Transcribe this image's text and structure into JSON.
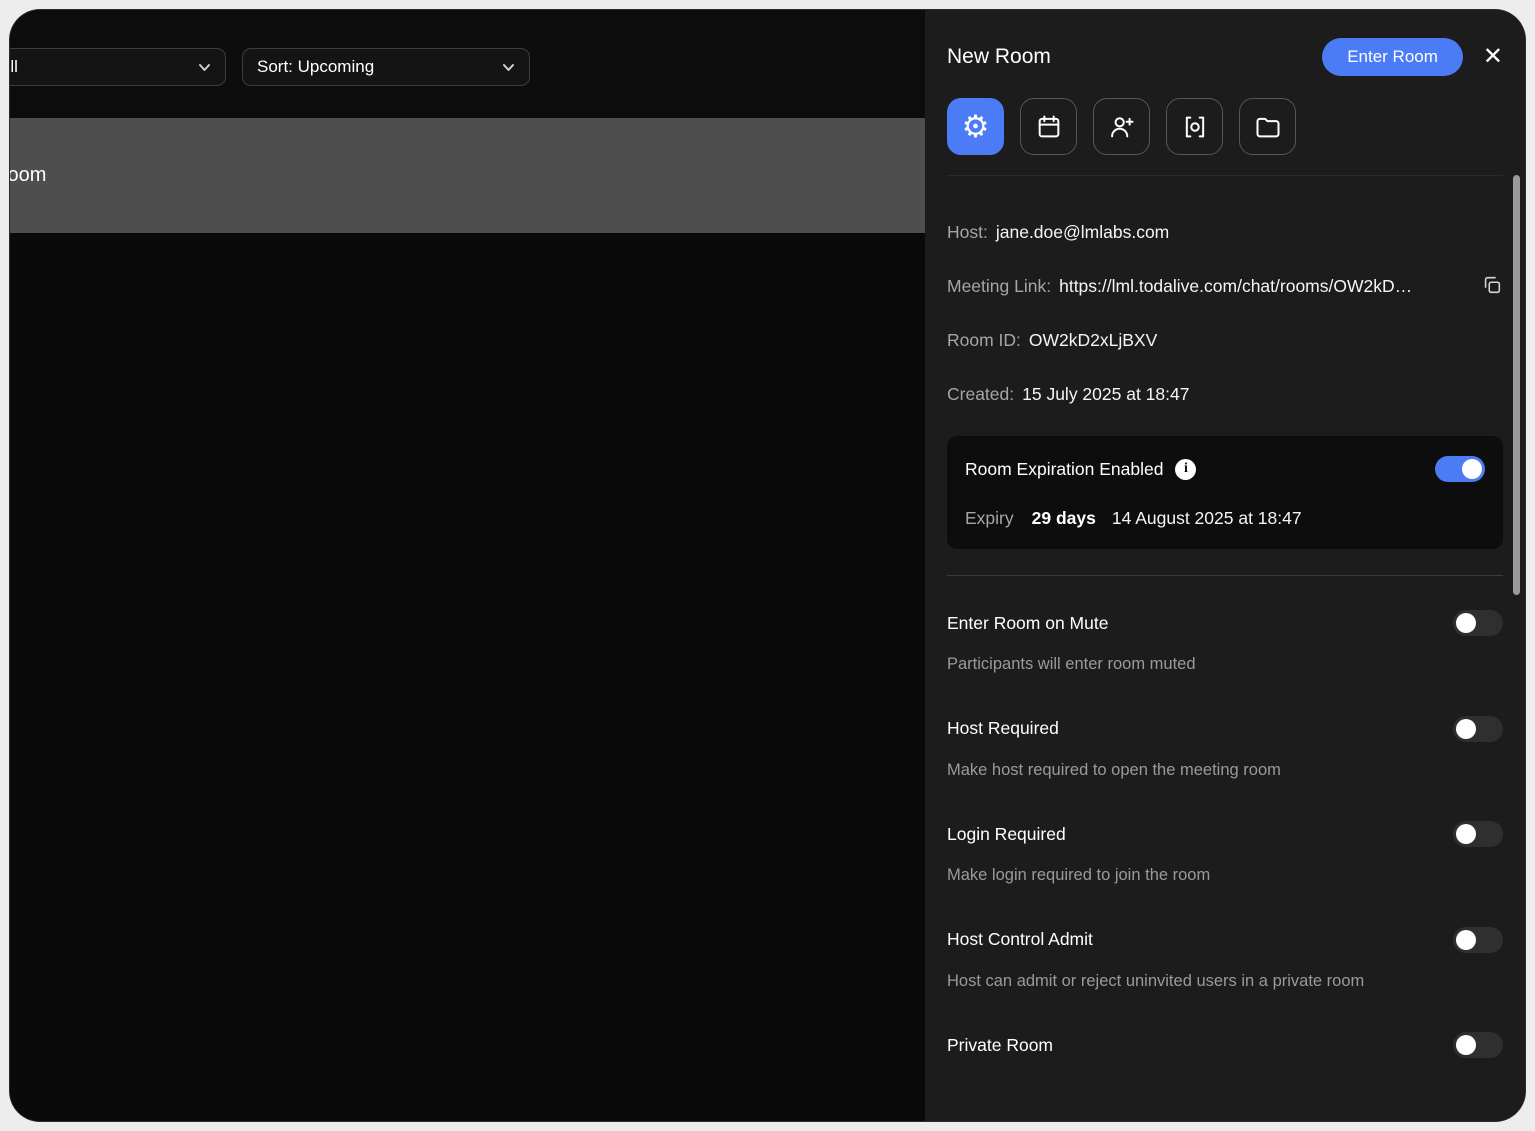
{
  "colors": {
    "accent": "#4b7bf5",
    "panel_bg": "#1c1c1c",
    "card_bg": "#0d0d0d",
    "strip_bg": "#4e4e4e"
  },
  "topbar": {
    "filter_dropdown": {
      "label": "All"
    },
    "sort_dropdown": {
      "label": "Sort: Upcoming"
    }
  },
  "content_header": {
    "title": "Room"
  },
  "panel": {
    "title": "New Room",
    "enter_room_button": "Enter Room",
    "tabs": [
      {
        "icon": "settings-icon",
        "active": true
      },
      {
        "icon": "calendar-icon",
        "active": false
      },
      {
        "icon": "add-participant-icon",
        "active": false
      },
      {
        "icon": "recording-icon",
        "active": false
      },
      {
        "icon": "files-icon",
        "active": false
      }
    ],
    "details": {
      "host": {
        "label": "Host:",
        "value": "jane.doe@lmlabs.com"
      },
      "meeting_link": {
        "label": "Meeting Link:",
        "value": "https://lml.todalive.com/chat/rooms/OW2kD…"
      },
      "room_id": {
        "label": "Room ID:",
        "value": "OW2kD2xLjBXV"
      },
      "created": {
        "label": "Created:",
        "value": "15 July 2025 at 18:47"
      }
    },
    "expiration": {
      "title": "Room Expiration Enabled",
      "enabled": true,
      "expiry_label": "Expiry",
      "expiry_days": "29 days",
      "expiry_date": "14 August 2025 at 18:47"
    },
    "settings": [
      {
        "label": "Enter Room on Mute",
        "description": "Participants will enter room muted",
        "enabled": false
      },
      {
        "label": "Host Required",
        "description": "Make host required to open the meeting room",
        "enabled": false
      },
      {
        "label": "Login Required",
        "description": "Make login required to join the room",
        "enabled": false
      },
      {
        "label": "Host Control Admit",
        "description": "Host can admit or reject uninvited users in a private room",
        "enabled": false
      },
      {
        "label": "Private Room",
        "description": "",
        "enabled": false
      }
    ]
  }
}
